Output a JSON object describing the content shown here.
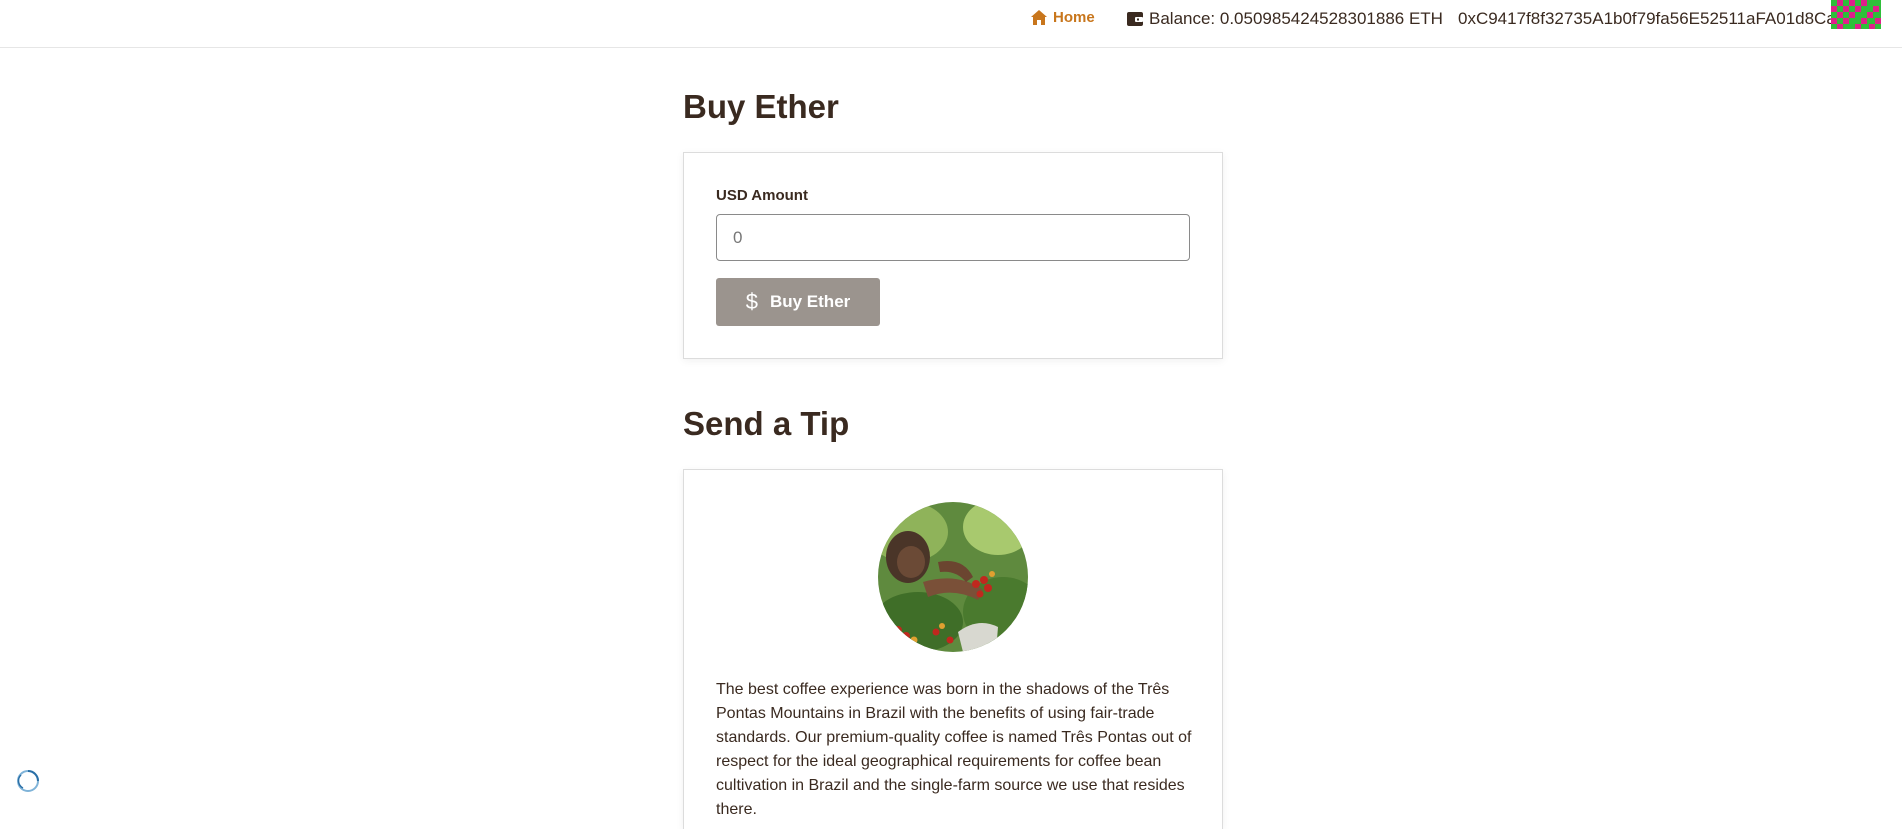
{
  "nav": {
    "home_label": "Home",
    "balance_text": "Balance: 0.050985424528301886 ETH",
    "address": "0xC9417f8f32735A1b0f79fa56E52511aFA01d8Ca1",
    "home_icon": "home-icon",
    "wallet_icon": "wallet-icon"
  },
  "buy": {
    "title": "Buy Ether",
    "field_label": "USD Amount",
    "input_placeholder": "0",
    "button_label": "Buy Ether",
    "button_icon": "dollar-icon"
  },
  "tip": {
    "title": "Send a Tip",
    "description": "The best coffee experience was born in the shadows of the Três Pontas Mountains in Brazil with the benefits of using fair-trade standards. Our premium-quality coffee is named Três Pontas out of respect for the ideal geographical requirements for coffee bean cultivation in Brazil and the single-farm source we use that resides there."
  },
  "colors": {
    "accent": "#c8761c",
    "text": "#3a2a20",
    "button_bg": "#9b948e"
  }
}
